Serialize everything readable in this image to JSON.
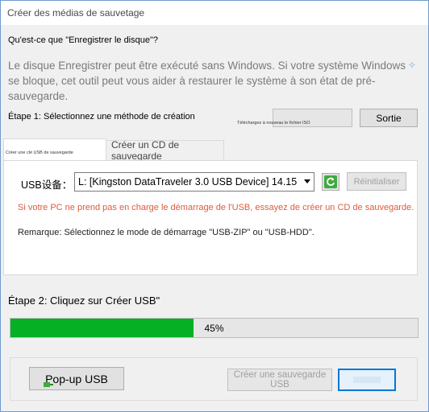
{
  "window": {
    "title": "Créer des médias de sauvetage"
  },
  "intro": {
    "question": "Qu'est-ce que \"Enregistrer le disque\"?",
    "description": "Le disque Enregistrer peut être exécuté sans Windows. Si votre système Windows se bloque, cet outil peut vous aider à restaurer le système à son état de pré-sauvegarde."
  },
  "step1": {
    "label": "Étape 1: Sélectionnez une méthode de création",
    "iso_label": "Téléchargez à nouveau le fichier ISO",
    "exit_label": "Sortie"
  },
  "tabs": [
    {
      "label": "Créer une clé USB de sauvegarde",
      "active": true
    },
    {
      "label": "Créer un CD de sauvegarde",
      "active": false
    }
  ],
  "usb_panel": {
    "device_label": "USB设备：",
    "selected_device": "L: [Kingston DataTraveler 3.0 USB Device] 14.15",
    "reset_label": "Réinitialiser",
    "warning": "Si votre PC ne prend pas en charge le démarrage de l'USB, essayez de créer un CD de sauvegarde.",
    "note": "Remarque: Sélectionnez le mode de démarrage \"USB-ZIP\" ou \"USB-HDD\"."
  },
  "step2": {
    "label": "Étape 2: Cliquez sur Créer USB\"",
    "progress_percent": 45,
    "progress_text": "45%"
  },
  "footer": {
    "popup_label": "Pop-up USB",
    "create_label": "Créer une sauvegarde USB"
  },
  "colors": {
    "progress_fill": "#06b025",
    "warning_text": "#e05a3a",
    "focus_border": "#0078d7"
  }
}
